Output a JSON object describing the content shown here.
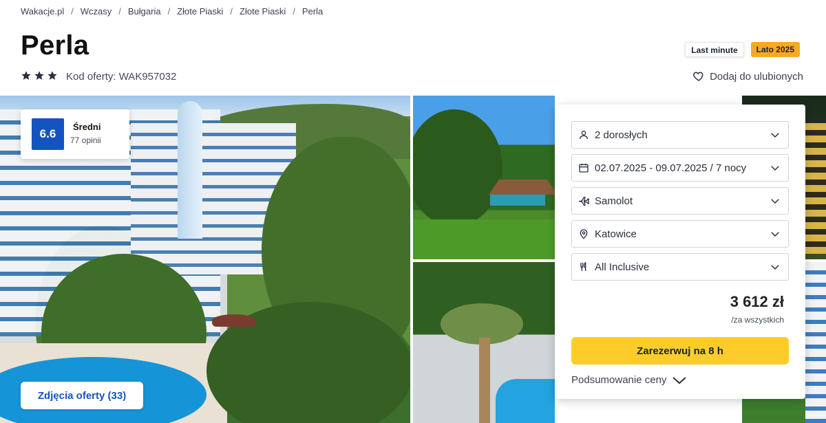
{
  "breadcrumb": [
    "Wakacje.pl",
    "Wczasy",
    "Bułgaria",
    "Złote Piaski",
    "Złote Piaski",
    "Perla"
  ],
  "breadcrumb_separator": "/",
  "hotel": {
    "name": "Perla",
    "stars": 3,
    "offer_code": "Kod oferty: WAK957032"
  },
  "tags": {
    "last_minute": "Last minute",
    "season": "Lato 2025"
  },
  "favorite_label": "Dodaj do ulubionych",
  "rating": {
    "score": "6.6",
    "label": "Średni",
    "count": "77 opinii"
  },
  "photos_button": "Zdjęcia oferty (33)",
  "booking": {
    "travelers": "2 dorosłych",
    "dates": "02.07.2025 - 09.07.2025 / 7 nocy",
    "transport": "Samolot",
    "departure": "Katowice",
    "board": "All Inclusive",
    "price": "3 612 zł",
    "price_note": "/za wszystkich",
    "book_button": "Zarezerwuj na 8 h",
    "summary_link": "Podsumowanie ceny"
  },
  "colors": {
    "rating_badge": "#1553c0",
    "book_button": "#fdcc2a",
    "season_tag": "#f9a825"
  },
  "icons": [
    "star-icon",
    "heart-icon",
    "person-icon",
    "calendar-icon",
    "plane-icon",
    "location-pin-icon",
    "cutlery-icon",
    "chevron-down-icon"
  ]
}
